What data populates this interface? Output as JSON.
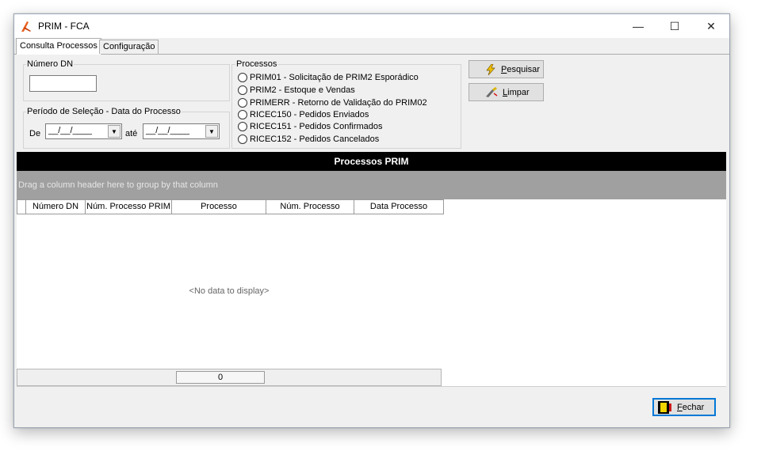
{
  "window": {
    "title": "PRIM - FCA",
    "controls": {
      "minimize": "—",
      "maximize": "☐",
      "close": "✕"
    }
  },
  "tabs": [
    {
      "label": "Consulta Processos"
    },
    {
      "label": "Configuração"
    }
  ],
  "filters": {
    "numero_dn_label": "Número DN",
    "numero_dn_value": "",
    "periodo_label": "Período de Seleção - Data do Processo",
    "de_label": "De",
    "de_value": "__/__/____",
    "ate_label": "até",
    "ate_value": "__/__/____"
  },
  "processos": {
    "label": "Processos",
    "options": [
      "PRIM01 - Solicitação de PRIM2 Esporádico",
      "PRIM2 - Estoque e Vendas",
      "PRIMERR - Retorno de Validação do PRIM02",
      "RICEC150 - Pedidos Enviados",
      "RICEC151 - Pedidos Confirmados",
      "RICEC152 - Pedidos Cancelados"
    ]
  },
  "buttons": {
    "pesquisar": {
      "accel": "P",
      "rest": "esquisar"
    },
    "limpar": {
      "accel": "L",
      "rest": "impar"
    },
    "fechar": {
      "accel": "F",
      "rest": "echar"
    }
  },
  "grid": {
    "title": "Processos PRIM",
    "group_hint": "Drag a column header here to group by that column",
    "columns": [
      "Número DN",
      "Núm. Processo PRIM",
      "Processo",
      "Núm. Processo",
      "Data Processo"
    ],
    "empty_text": "<No data to display>",
    "footer_count": "0"
  }
}
